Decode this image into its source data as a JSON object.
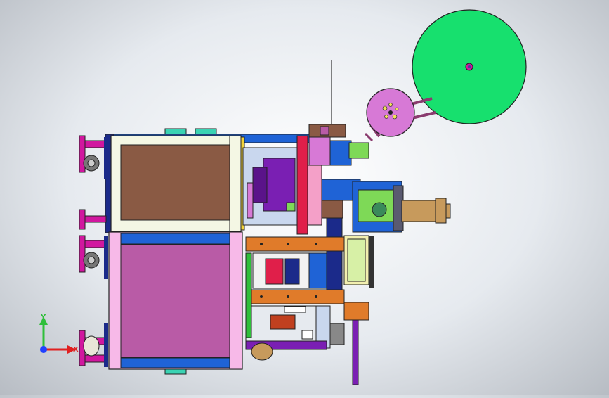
{
  "app": {
    "background_color": "#d9dde2"
  },
  "triad": {
    "y_label": "Y",
    "x_label": "X",
    "y_color": "#2fbf3a",
    "x_color": "#e02020",
    "origin_color": "#2040ff"
  },
  "colors": {
    "green_reel": "#17e06e",
    "purple_reel": "#d779d6",
    "brown_panel": "#8a5a44",
    "mauve_panel": "#b95ba6",
    "frame_cream": "#f4f7e4",
    "frame_pink": "#f7b9e8",
    "blue_bar": "#1f63d6",
    "navy": "#1b2a8a",
    "orange_rail": "#e07b2a",
    "magenta": "#d1179f",
    "red_plate": "#e01f4a",
    "purple_motor": "#7a1fb3",
    "cylinder_tan": "#c79a5c",
    "lime": "#7ed957"
  },
  "icons": [
    "coordinate-triad-icon"
  ]
}
